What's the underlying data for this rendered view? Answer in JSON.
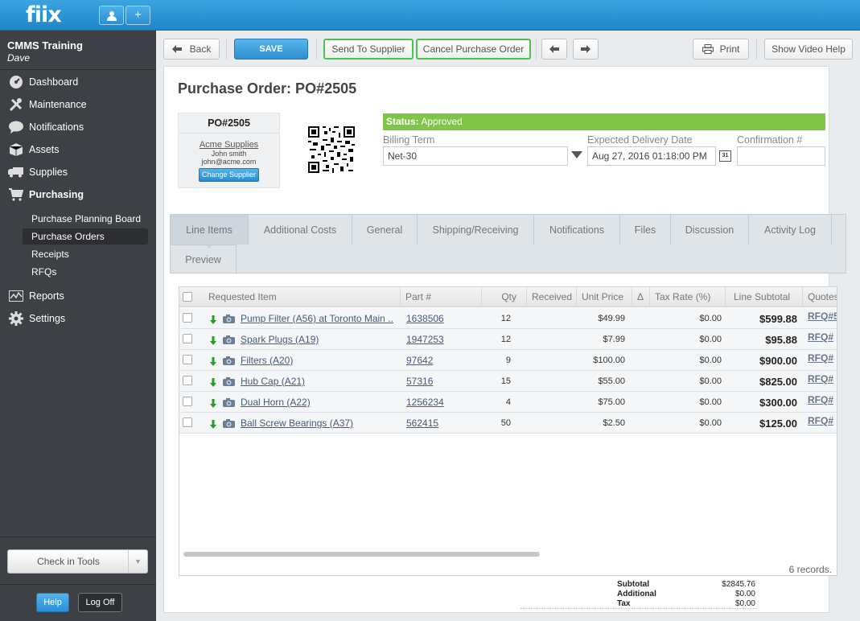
{
  "app": {
    "logo": "fiix"
  },
  "topbar": {
    "user_btn_icon": "user-icon",
    "add_btn_label": "+"
  },
  "org": {
    "name": "CMMS Training",
    "user": "Dave"
  },
  "nav": {
    "dashboard": "Dashboard",
    "maintenance": "Maintenance",
    "notifications": "Notifications",
    "assets": "Assets",
    "supplies": "Supplies",
    "purchasing": "Purchasing",
    "purchasing_sub": [
      "Purchase Planning Board",
      "Purchase Orders",
      "Receipts",
      "RFQs"
    ],
    "reports": "Reports",
    "settings": "Settings"
  },
  "sidebar_footer": {
    "check_in": "Check in Tools",
    "help": "Help",
    "logoff": "Log Off"
  },
  "toolbar": {
    "back": "Back",
    "save": "SAVE",
    "send_to_supplier": "Send To Supplier",
    "cancel_po": "Cancel Purchase Order",
    "print": "Print",
    "video_help": "Show Video Help"
  },
  "po": {
    "title": "Purchase Order: PO#2505",
    "number": "PO#2505",
    "supplier_name": "Acme Supplies",
    "contact_name": "John smith",
    "contact_email": "john@acme.com",
    "change_supplier": "Change Supplier",
    "status_label": "Status:",
    "status_value": "Approved",
    "billing_term_label": "Billing Term",
    "billing_term_value": "Net-30",
    "delivery_label": "Expected Delivery Date",
    "delivery_value": "Aug 27, 2016 01:18:00 PM",
    "calendar_day": "31",
    "confirmation_label": "Confirmation #",
    "confirmation_value": ""
  },
  "tabs": [
    "Line Items",
    "Additional Costs",
    "General",
    "Shipping/Receiving",
    "Notifications",
    "Files",
    "Discussion",
    "Activity Log",
    "Preview"
  ],
  "grid": {
    "headers": [
      "Requested Item",
      "Part #",
      "Qty",
      "Received",
      "Unit Price",
      "Δ",
      "Tax Rate (%)",
      "Line Subtotal",
      "Quotes"
    ],
    "rows": [
      {
        "item": "Pump Filter (A56) at Toronto Main ...",
        "part": "1638506",
        "qty": "12",
        "price": "$49.99",
        "tax": "$0.00",
        "subtotal": "$599.88",
        "quote": "RFQ#5"
      },
      {
        "item": "Spark Plugs (A19)",
        "part": "1947253",
        "qty": "12",
        "price": "$7.99",
        "tax": "$0.00",
        "subtotal": "$95.88",
        "quote": "RFQ#"
      },
      {
        "item": "Filters (A20)",
        "part": "97642",
        "qty": "9",
        "price": "$100.00",
        "tax": "$0.00",
        "subtotal": "$900.00",
        "quote": "RFQ#"
      },
      {
        "item": "Hub Cap (A21)",
        "part": "57316",
        "qty": "15",
        "price": "$55.00",
        "tax": "$0.00",
        "subtotal": "$825.00",
        "quote": "RFQ#"
      },
      {
        "item": "Dual Horn (A22)",
        "part": "1256234",
        "qty": "4",
        "price": "$75.00",
        "tax": "$0.00",
        "subtotal": "$300.00",
        "quote": "RFQ#"
      },
      {
        "item": "Ball Screw Bearings (A37)",
        "part": "562415",
        "qty": "50",
        "price": "$2.50",
        "tax": "$0.00",
        "subtotal": "$125.00",
        "quote": "RFQ#"
      }
    ],
    "records": "6 records."
  },
  "totals": [
    {
      "label": "Subtotal",
      "value": "$2845.76"
    },
    {
      "label": "Additional",
      "value": "$0.00"
    },
    {
      "label": "Tax",
      "value": "$0.00"
    }
  ],
  "colors": {
    "accent": "#2f8ed0",
    "status_green": "#7dc646",
    "sidebar": "#3d4044",
    "highlight_border": "#4cc44c"
  }
}
